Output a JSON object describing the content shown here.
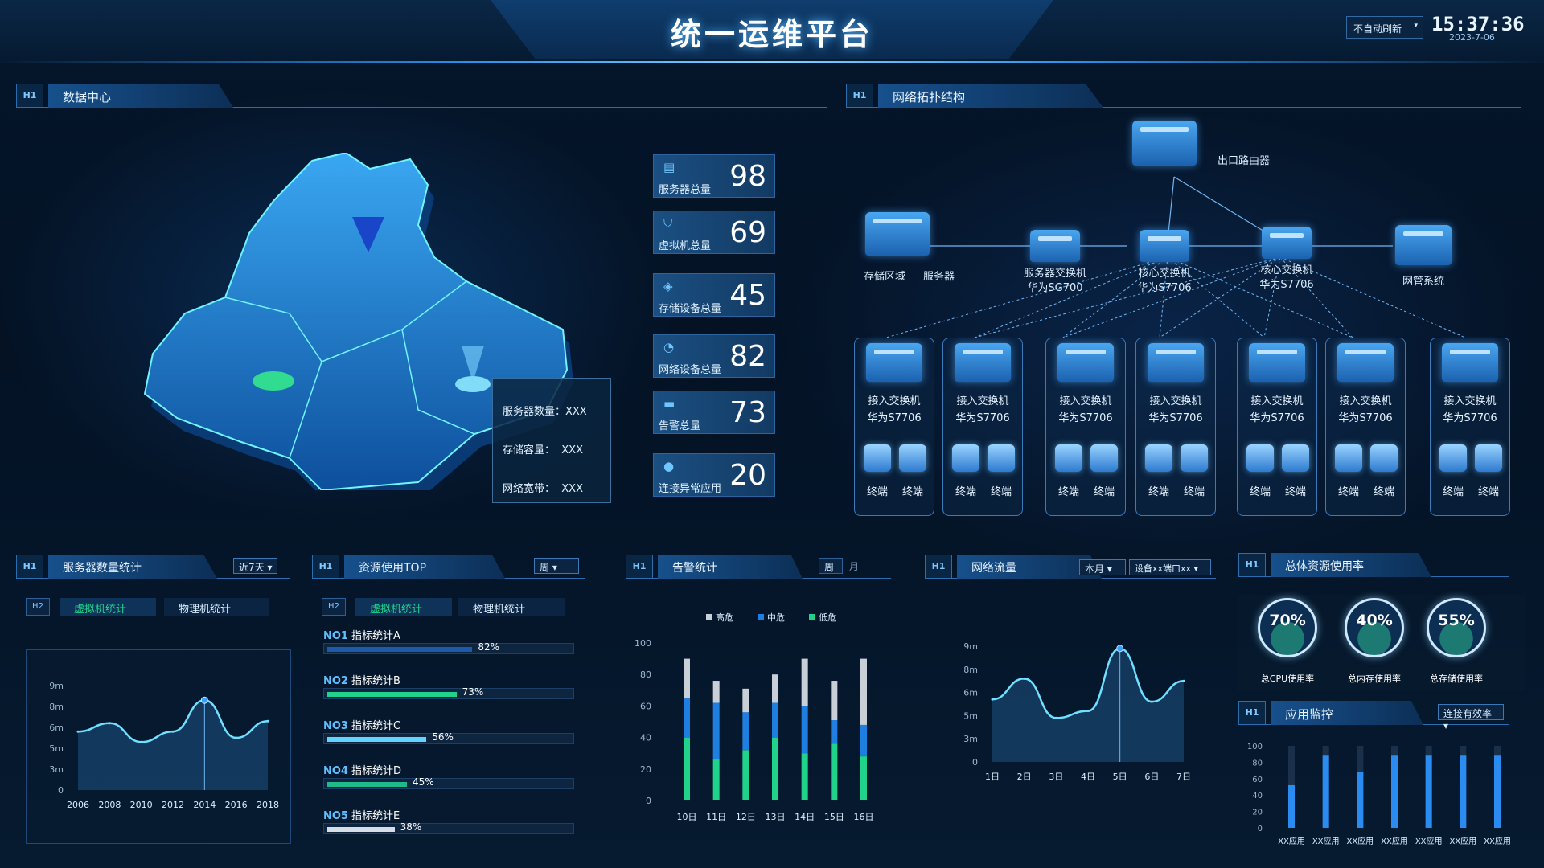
{
  "header": {
    "title": "统一运维平台",
    "refresh_label": "不自动刷新",
    "time": "15:37:36",
    "date": "2023-7-06"
  },
  "h1_tag": "H1",
  "h2_tag": "H2",
  "datacenter": {
    "title": "数据中心",
    "popup": {
      "servers": "服务器数量：XXX",
      "storage_label": "存储容量：",
      "storage_val": "XXX",
      "bandwidth_label": "网络宽带：",
      "bandwidth_val": "XXX"
    },
    "cards": [
      {
        "label": "服务器总量",
        "value": "98",
        "icon": "server-icon"
      },
      {
        "label": "虚拟机总量",
        "value": "69",
        "icon": "shield-icon"
      },
      {
        "label": "存储设备总量",
        "value": "45",
        "icon": "storage-icon"
      },
      {
        "label": "网络设备总量",
        "value": "82",
        "icon": "network-icon"
      },
      {
        "label": "告警总量",
        "value": "73",
        "icon": "alarm-icon"
      },
      {
        "label": "连接异常应用",
        "value": "20",
        "icon": "user-icon"
      }
    ]
  },
  "topology": {
    "title": "网络拓扑结构",
    "router": "出口路由器",
    "storage": "存储区域",
    "server": "服务器",
    "server_switch": [
      "服务器交换机",
      "华为SG700"
    ],
    "core1": [
      "核心交换机",
      "华为S7706"
    ],
    "core2": [
      "核心交换机",
      "华为S7706"
    ],
    "nms": "网管系统",
    "access": [
      {
        "l1": "接入交换机",
        "l2": "华为S7706"
      },
      {
        "l1": "接入交换机",
        "l2": "华为S7706"
      },
      {
        "l1": "接入交换机",
        "l2": "华为S7706"
      },
      {
        "l1": "接入交换机",
        "l2": "华为S7706"
      },
      {
        "l1": "接入交换机",
        "l2": "华为S7706"
      },
      {
        "l1": "接入交换机",
        "l2": "华为S7706"
      },
      {
        "l1": "接入交换机",
        "l2": "华为S7706"
      }
    ],
    "terminal": "终端"
  },
  "server_stats": {
    "title": "服务器数量统计",
    "range": "近7天",
    "tab_virtual": "虚拟机统计",
    "tab_physical": "物理机统计"
  },
  "resource_top": {
    "title": "资源使用TOP",
    "range": "周",
    "tab_virtual": "虚拟机统计",
    "tab_physical": "物理机统计",
    "items": [
      {
        "no": "NO1",
        "name": "指标统计A",
        "pct": "82%",
        "value": 82,
        "color": "#1f5aa8"
      },
      {
        "no": "NO2",
        "name": "指标统计B",
        "pct": "73%",
        "value": 73,
        "color": "#1fd38a"
      },
      {
        "no": "NO3",
        "name": "指标统计C",
        "pct": "56%",
        "value": 56,
        "color": "#62d4ff"
      },
      {
        "no": "NO4",
        "name": "指标统计D",
        "pct": "45%",
        "value": 45,
        "color": "#1fb98a"
      },
      {
        "no": "NO5",
        "name": "指标统计E",
        "pct": "38%",
        "value": 38,
        "color": "#d5dde6"
      }
    ]
  },
  "alarm_stats": {
    "title": "告警统计",
    "opt_week": "周",
    "opt_month": "月"
  },
  "net_flow": {
    "title": "网络流量",
    "range": "本月",
    "device": "设备xx端口xx"
  },
  "overall": {
    "title": "总体资源使用率",
    "gauges": [
      {
        "value": "70%",
        "label": "总CPU使用率"
      },
      {
        "value": "40%",
        "label": "总内存使用率"
      },
      {
        "value": "55%",
        "label": "总存储使用率"
      }
    ]
  },
  "app_monitor": {
    "title": "应用监控",
    "select": "连接有效率"
  },
  "colors": {
    "accent": "#3aa0ff",
    "high": "#c9cfd6",
    "mid": "#1f7fe0",
    "low": "#1fd38a"
  },
  "chart_data": [
    {
      "type": "line",
      "panel": "服务器数量统计",
      "x": [
        "2006",
        "2008",
        "2010",
        "2012",
        "2014",
        "2016",
        "2018"
      ],
      "y_ticks": [
        "0",
        "3m",
        "5m",
        "6m",
        "8m",
        "9m"
      ],
      "values": [
        5.6,
        6.4,
        4.6,
        5.6,
        8.6,
        5.0,
        6.6
      ]
    },
    {
      "type": "bar",
      "panel": "告警统计",
      "categories": [
        "10日",
        "11日",
        "12日",
        "13日",
        "14日",
        "15日",
        "16日"
      ],
      "ylim": [
        0,
        100
      ],
      "y_ticks": [
        "0",
        "20",
        "40",
        "60",
        "80",
        "100"
      ],
      "legend": [
        "高危",
        "中危",
        "低危"
      ],
      "series": [
        {
          "name": "低危",
          "values": [
            40,
            26,
            32,
            40,
            30,
            36,
            28
          ]
        },
        {
          "name": "中危",
          "values": [
            25,
            36,
            24,
            22,
            30,
            15,
            20
          ]
        },
        {
          "name": "高危",
          "values": [
            25,
            14,
            15,
            18,
            30,
            25,
            42
          ]
        }
      ]
    },
    {
      "type": "line",
      "panel": "网络流量",
      "x": [
        "1日",
        "2日",
        "3日",
        "4日",
        "5日",
        "6日",
        "7日"
      ],
      "y_ticks": [
        "0",
        "3m",
        "5m",
        "6m",
        "8m",
        "9m"
      ],
      "values": [
        5.4,
        7.2,
        3.8,
        4.4,
        9.8,
        5.2,
        7.0
      ]
    },
    {
      "type": "bar",
      "panel": "应用监控",
      "categories": [
        "XX应用",
        "XX应用",
        "XX应用",
        "XX应用",
        "XX应用",
        "XX应用",
        "XX应用"
      ],
      "ylim": [
        0,
        100
      ],
      "y_ticks": [
        "0",
        "20",
        "40",
        "60",
        "80",
        "100"
      ],
      "values": [
        52,
        88,
        68,
        88,
        88,
        88,
        88
      ]
    }
  ]
}
